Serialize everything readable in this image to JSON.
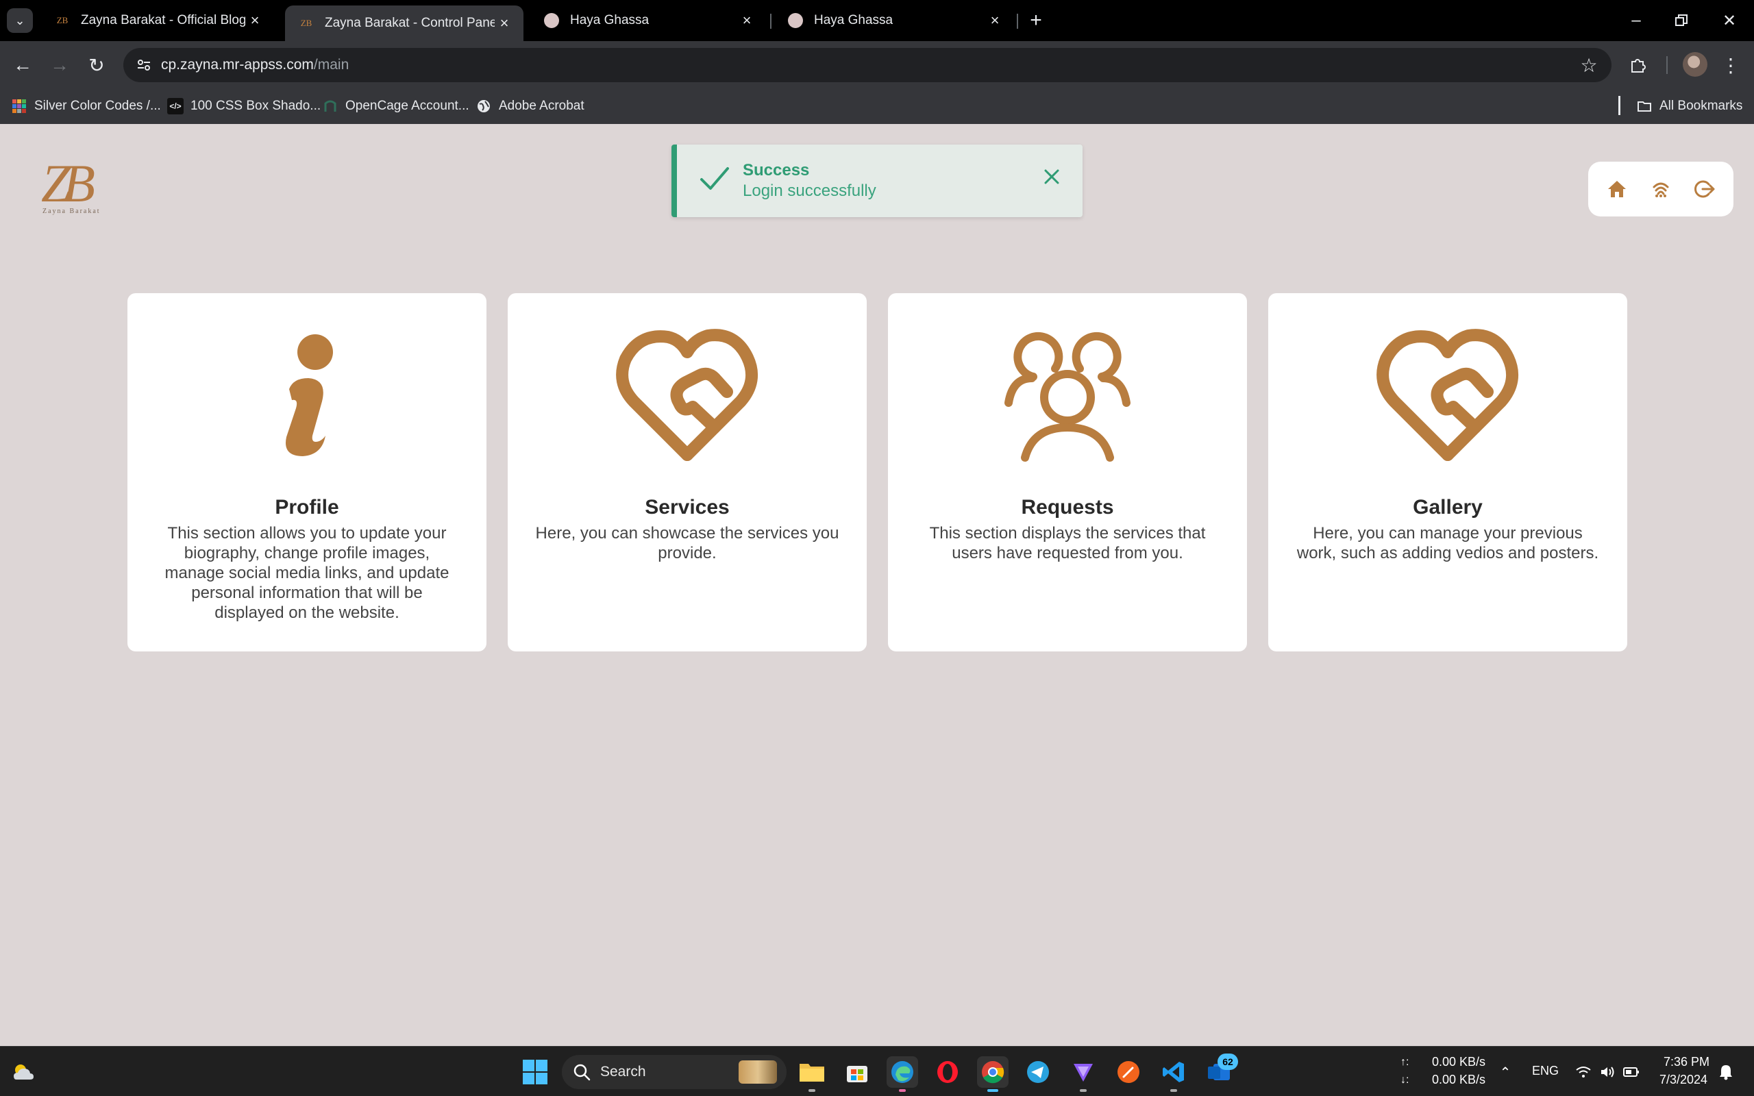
{
  "browser": {
    "tabs": [
      {
        "title": "Zayna Barakat - Official Blogger",
        "favicon": "ZB",
        "active": false
      },
      {
        "title": "Zayna Barakat - Control Panel",
        "favicon": "ZB",
        "active": true
      },
      {
        "title": "Haya Ghassa",
        "favicon": "",
        "active": false
      },
      {
        "title": "Haya Ghassa",
        "favicon": "",
        "active": false
      }
    ],
    "url_domain": "cp.zayna.mr-appss.com",
    "url_path": "/main",
    "bookmarks": [
      {
        "label": "Silver Color Codes /..."
      },
      {
        "label": "100 CSS Box Shado..."
      },
      {
        "label": "OpenCage Account..."
      },
      {
        "label": "Adobe Acrobat"
      }
    ],
    "all_bookmarks": "All Bookmarks"
  },
  "page": {
    "brand_color": "#b87d3f",
    "logo_letters": "ZB",
    "logo_sub": "Zayna Barakat",
    "toast": {
      "title": "Success",
      "message": "Login successfully",
      "color": "#2f9c74"
    },
    "cards": [
      {
        "title": "Profile",
        "description": "This section allows you to update your biography, change profile images, manage social media links, and update personal information that will be displayed on the website.",
        "icon": "info-icon"
      },
      {
        "title": "Services",
        "description": "Here, you can showcase the services you provide.",
        "icon": "handshake-heart-icon"
      },
      {
        "title": "Requests",
        "description": "This section displays the services that users have requested from you.",
        "icon": "users-icon"
      },
      {
        "title": "Gallery",
        "description": "Here, you can manage your previous work, such as adding vedios and posters.",
        "icon": "handshake-heart-icon"
      }
    ]
  },
  "taskbar": {
    "search_label": "Search",
    "badge_count": "62",
    "net_up": "0.00 KB/s",
    "net_down": "0.00 KB/s",
    "lang": "ENG",
    "time": "7:36 PM",
    "date": "7/3/2024"
  }
}
